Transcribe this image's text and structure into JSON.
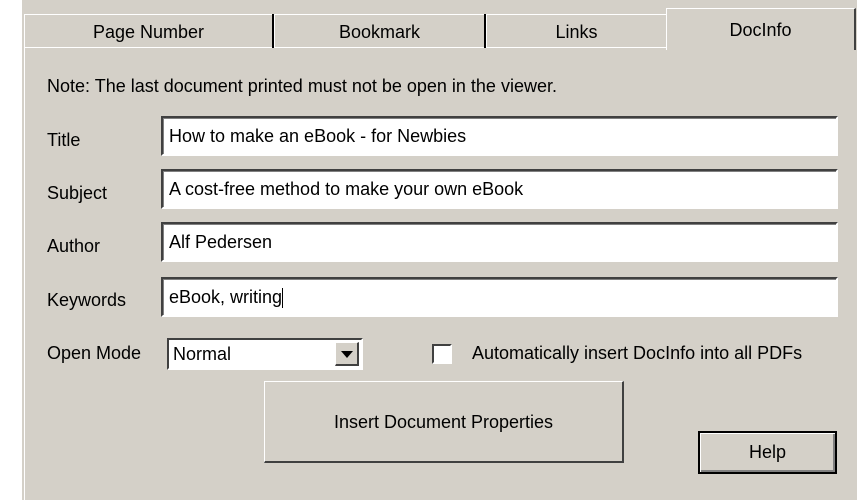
{
  "tabs": [
    {
      "label": "Page Number",
      "active": false
    },
    {
      "label": "Bookmark",
      "active": false
    },
    {
      "label": "Links",
      "active": false
    },
    {
      "label": "DocInfo",
      "active": true
    }
  ],
  "note": "Note: The last document printed must not be open in the viewer.",
  "fields": {
    "title": {
      "label": "Title",
      "value": "How to make an eBook - for Newbies"
    },
    "subject": {
      "label": "Subject",
      "value": "A cost-free method to make your own eBook"
    },
    "author": {
      "label": "Author",
      "value": "Alf Pedersen"
    },
    "keywords": {
      "label": "Keywords",
      "value": "eBook, writing"
    }
  },
  "open_mode": {
    "label": "Open Mode",
    "selected": "Normal"
  },
  "auto_insert": {
    "label": "Automatically insert DocInfo into all PDFs",
    "checked": false
  },
  "buttons": {
    "insert": "Insert Document Properties",
    "help": "Help"
  },
  "colors": {
    "face": "#d4d0c8",
    "shadow": "#404040",
    "highlight": "#ffffff"
  }
}
